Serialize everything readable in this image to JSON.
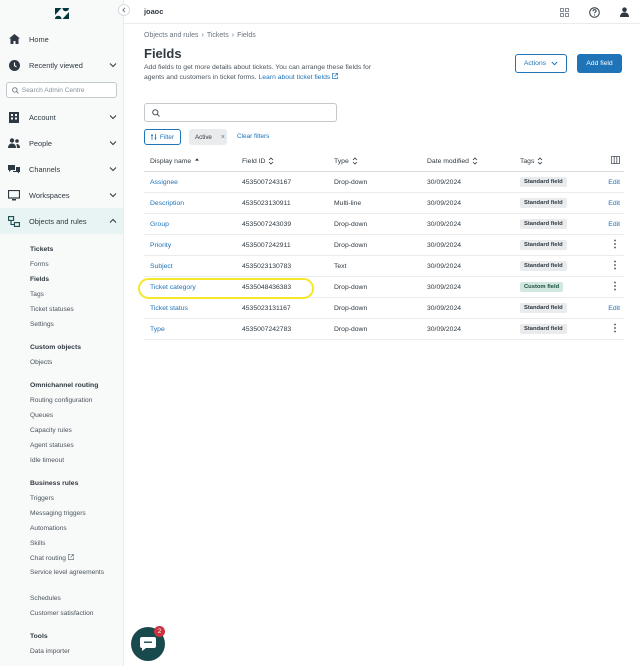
{
  "topbar": {
    "org": "joaoc"
  },
  "sidebar": {
    "search_placeholder": "Search Admin Centre",
    "items": [
      {
        "label": "Home",
        "icon": "home-icon"
      },
      {
        "label": "Recently viewed",
        "icon": "clock-icon"
      },
      {
        "label": "Account",
        "icon": "building-icon"
      },
      {
        "label": "People",
        "icon": "people-icon"
      },
      {
        "label": "Channels",
        "icon": "channels-icon"
      },
      {
        "label": "Workspaces",
        "icon": "monitor-icon"
      },
      {
        "label": "Objects and rules",
        "icon": "objects-icon"
      }
    ],
    "groups": [
      {
        "heading": "Tickets",
        "links": [
          "Forms",
          "Fields",
          "Tags",
          "Ticket statuses",
          "Settings"
        ]
      },
      {
        "heading": "Custom objects",
        "links": [
          "Objects"
        ]
      },
      {
        "heading": "Omnichannel routing",
        "links": [
          "Routing configuration",
          "Queues",
          "Capacity rules",
          "Agent statuses",
          "Idle timeout"
        ]
      },
      {
        "heading": "Business rules",
        "links": [
          "Triggers",
          "Messaging triggers",
          "Automations",
          "Skills",
          "Chat routing",
          "Service level agreements",
          "Schedules",
          "Customer satisfaction"
        ]
      },
      {
        "heading": "Tools",
        "links": [
          "Data importer"
        ]
      }
    ]
  },
  "breadcrumb": [
    "Objects and rules",
    "Tickets",
    "Fields"
  ],
  "page": {
    "title": "Fields",
    "description": "Add fields to get more details about tickets. You can arrange these fields for agents and customers in ticket forms.",
    "learn_more": "Learn about ticket fields",
    "actions_label": "Actions",
    "add_label": "Add field",
    "search_placeholder": "",
    "filter_label": "Filter",
    "chip_label": "Active",
    "clear_label": "Clear filters"
  },
  "table": {
    "headers": [
      "Display name",
      "Field ID",
      "Type",
      "Date modified",
      "Tags"
    ],
    "rows": [
      {
        "name": "Assignee",
        "id": "4535007243167",
        "type": "Drop-down",
        "date": "30/09/2024",
        "tag": "Standard field",
        "action": "Edit"
      },
      {
        "name": "Description",
        "id": "4535023130911",
        "type": "Multi-line",
        "date": "30/09/2024",
        "tag": "Standard field",
        "action": "Edit"
      },
      {
        "name": "Group",
        "id": "4535007243039",
        "type": "Drop-down",
        "date": "30/09/2024",
        "tag": "Standard field",
        "action": "Edit"
      },
      {
        "name": "Priority",
        "id": "4535007242911",
        "type": "Drop-down",
        "date": "30/09/2024",
        "tag": "Standard field",
        "action": "⋮"
      },
      {
        "name": "Subject",
        "id": "4535023130783",
        "type": "Text",
        "date": "30/09/2024",
        "tag": "Standard field",
        "action": "⋮"
      },
      {
        "name": "Ticket category",
        "id": "4535048436383",
        "type": "Drop-down",
        "date": "30/09/2024",
        "tag": "Custom field",
        "action": "⋮"
      },
      {
        "name": "Ticket status",
        "id": "4535023131167",
        "type": "Drop-down",
        "date": "30/09/2024",
        "tag": "Standard field",
        "action": "Edit"
      },
      {
        "name": "Type",
        "id": "4535007242783",
        "type": "Drop-down",
        "date": "30/09/2024",
        "tag": "Standard field",
        "action": "⋮"
      }
    ]
  },
  "chat": {
    "badge": "2"
  },
  "colors": {
    "accent": "#1f73b7",
    "highlight": "#f4e72a",
    "chat": "#17494d",
    "badge": "#cc3340"
  }
}
